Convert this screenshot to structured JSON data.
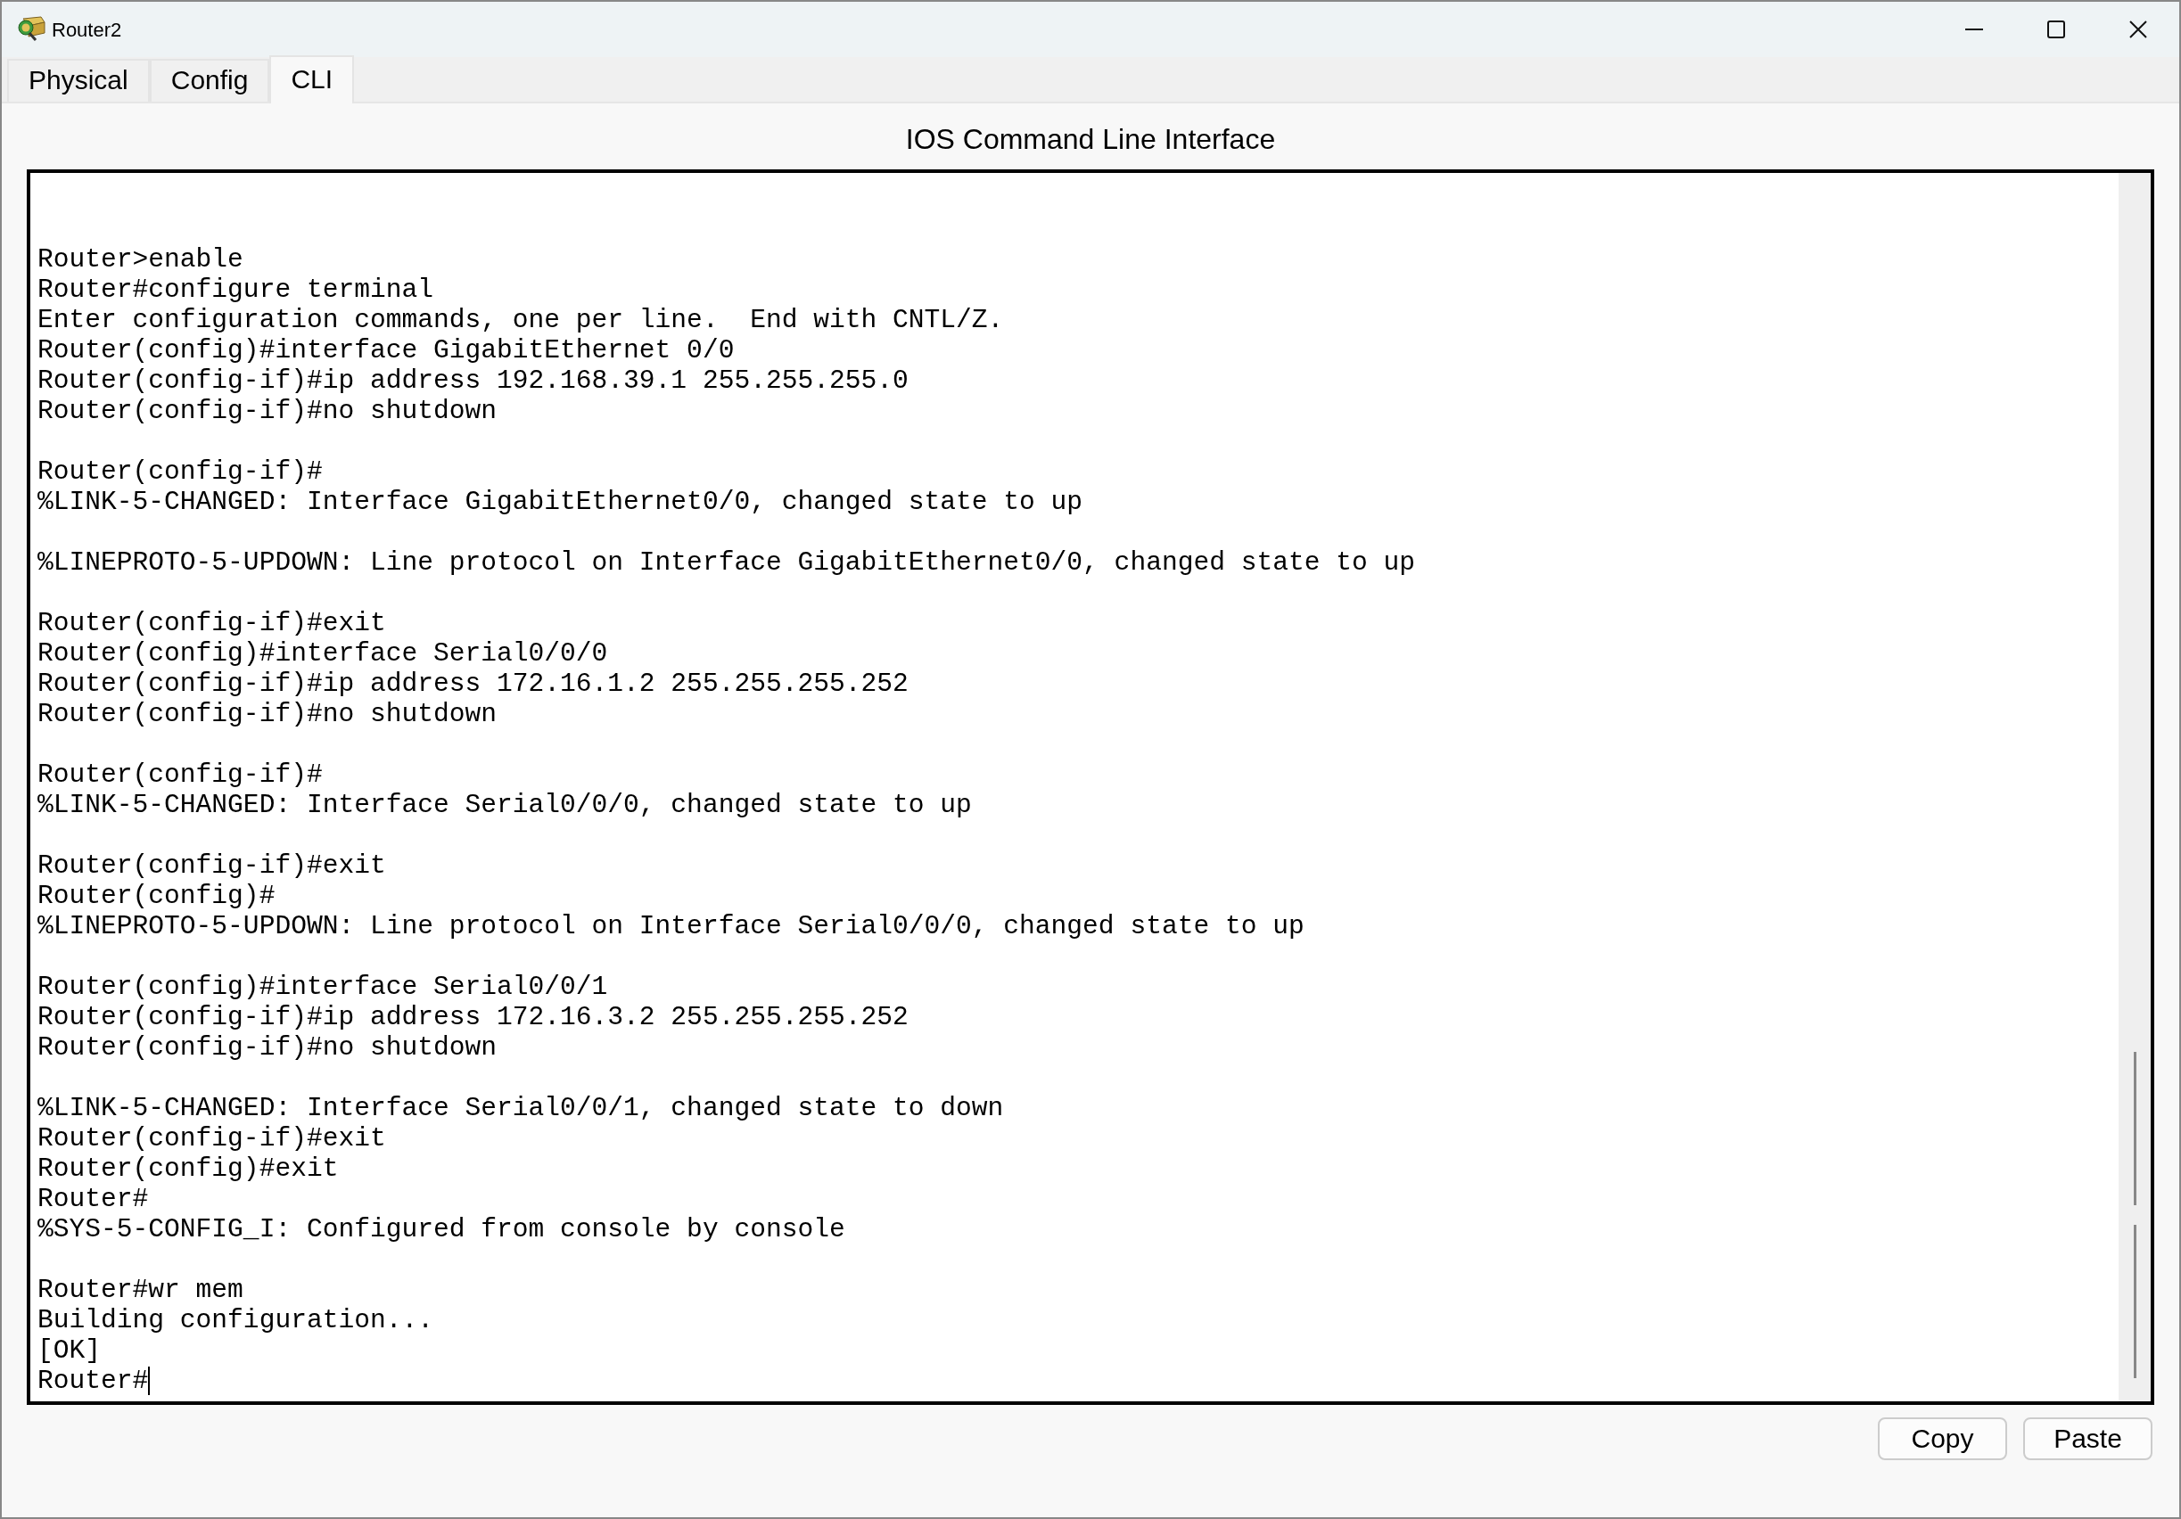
{
  "window": {
    "title": "Router2"
  },
  "tabs": [
    {
      "label": "Physical",
      "selected": false
    },
    {
      "label": "Config",
      "selected": false
    },
    {
      "label": "CLI",
      "selected": true
    }
  ],
  "heading": "IOS Command Line Interface",
  "terminal": {
    "blocks": [
      [
        "Router>enable",
        "Router#configure terminal",
        "Enter configuration commands, one per line.  End with CNTL/Z.",
        "Router(config)#interface GigabitEthernet 0/0",
        "Router(config-if)#ip address 192.168.39.1 255.255.255.0",
        "Router(config-if)#no shutdown"
      ],
      [
        "Router(config-if)#",
        "%LINK-5-CHANGED: Interface GigabitEthernet0/0, changed state to up"
      ],
      [
        "%LINEPROTO-5-UPDOWN: Line protocol on Interface GigabitEthernet0/0, changed state to up"
      ],
      [
        "Router(config-if)#exit",
        "Router(config)#interface Serial0/0/0",
        "Router(config-if)#ip address 172.16.1.2 255.255.255.252",
        "Router(config-if)#no shutdown"
      ],
      [
        "Router(config-if)#",
        "%LINK-5-CHANGED: Interface Serial0/0/0, changed state to up"
      ],
      [
        "Router(config-if)#exit",
        "Router(config)#",
        "%LINEPROTO-5-UPDOWN: Line protocol on Interface Serial0/0/0, changed state to up"
      ],
      [
        "Router(config)#interface Serial0/0/1",
        "Router(config-if)#ip address 172.16.3.2 255.255.255.252",
        "Router(config-if)#no shutdown"
      ],
      [
        "%LINK-5-CHANGED: Interface Serial0/0/1, changed state to down",
        "Router(config-if)#exit",
        "Router(config)#exit",
        "Router#",
        "%SYS-5-CONFIG_I: Configured from console by console"
      ],
      [
        "Router#wr mem",
        "Building configuration...",
        "[OK]",
        "Router#"
      ]
    ]
  },
  "buttons": [
    "Copy",
    "Paste"
  ]
}
